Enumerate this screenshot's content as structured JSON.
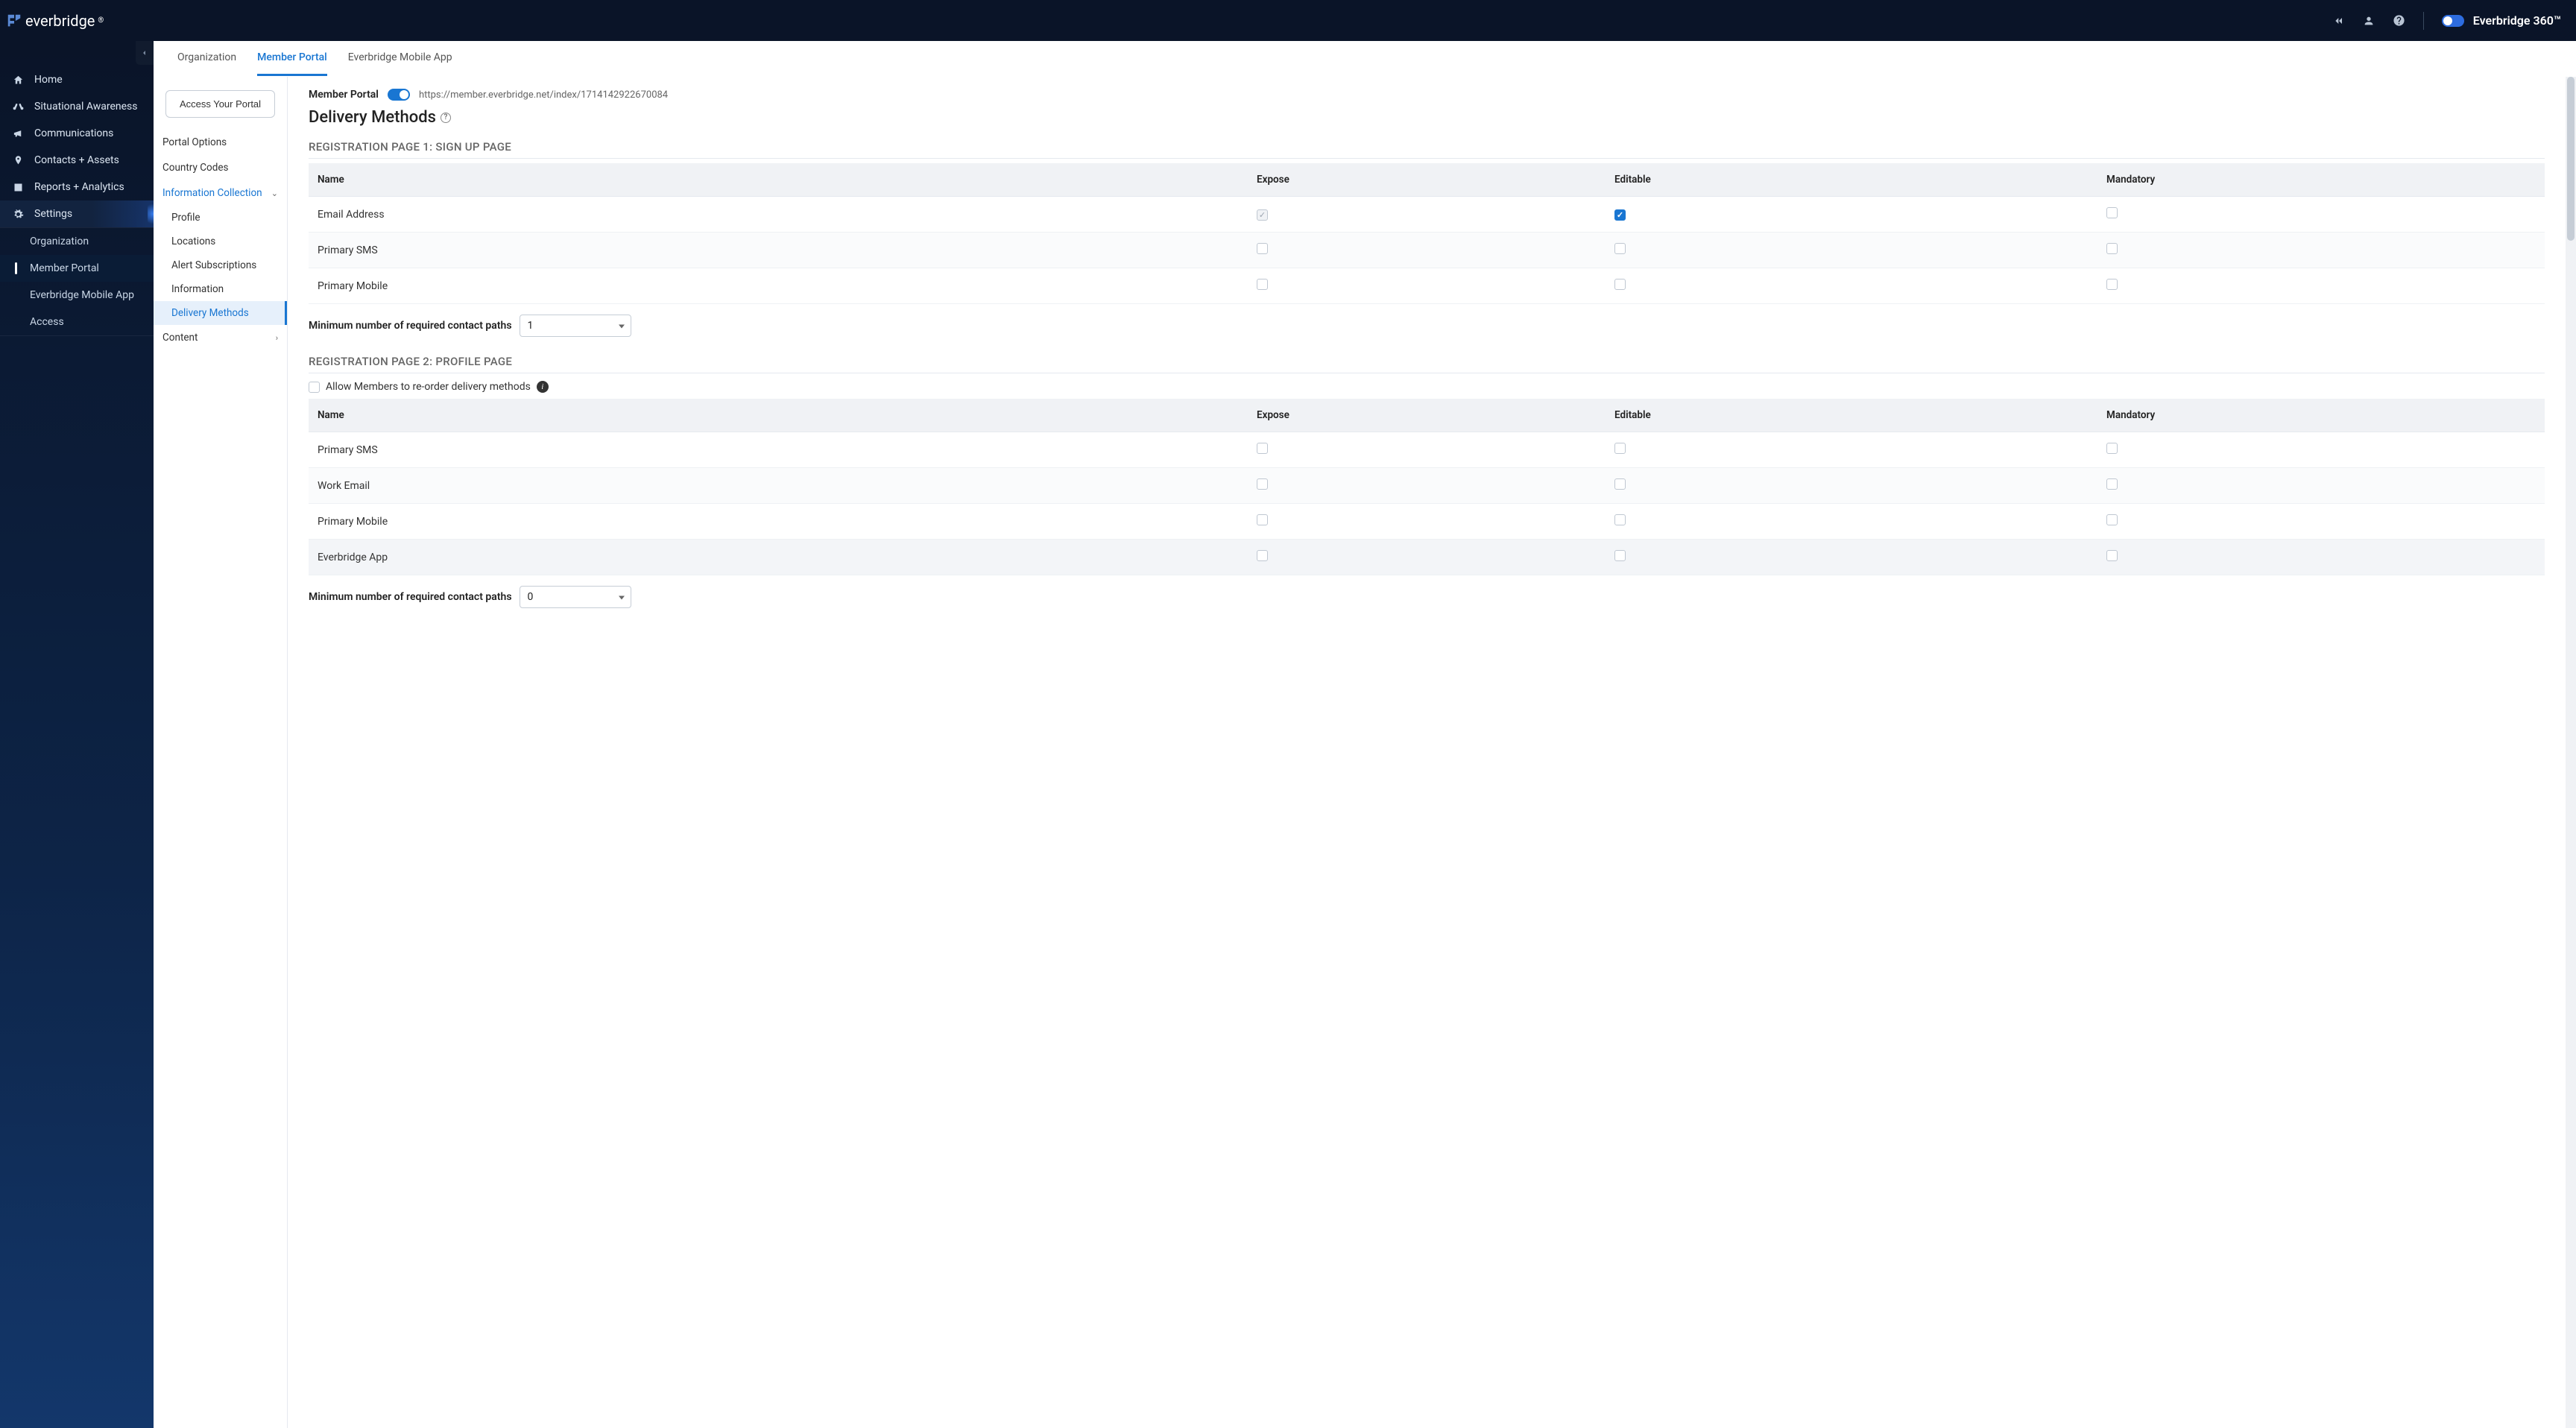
{
  "topbar": {
    "brand": "everbridge",
    "brand360": "Everbridge 360™"
  },
  "sidebar": {
    "items": [
      {
        "label": "Home"
      },
      {
        "label": "Situational Awareness"
      },
      {
        "label": "Communications"
      },
      {
        "label": "Contacts + Assets"
      },
      {
        "label": "Reports + Analytics"
      },
      {
        "label": "Settings"
      }
    ],
    "sub": [
      {
        "label": "Organization"
      },
      {
        "label": "Member Portal"
      },
      {
        "label": "Everbridge Mobile App"
      },
      {
        "label": "Access"
      }
    ]
  },
  "tabs": {
    "items": [
      {
        "label": "Organization"
      },
      {
        "label": "Member Portal"
      },
      {
        "label": "Everbridge Mobile App"
      }
    ]
  },
  "tree": {
    "access_btn": "Access Your Portal",
    "items": {
      "portal_options": "Portal Options",
      "country_codes": "Country Codes",
      "info_collection": "Information Collection",
      "profile": "Profile",
      "locations": "Locations",
      "alert_subs": "Alert Subscriptions",
      "information": "Information",
      "delivery_methods": "Delivery Methods",
      "content": "Content"
    }
  },
  "header": {
    "mp_label": "Member Portal",
    "mp_url": "https://member.everbridge.net/index/1714142922670084",
    "title": "Delivery Methods"
  },
  "section1": {
    "heading": "REGISTRATION PAGE 1: SIGN UP PAGE",
    "cols": {
      "name": "Name",
      "expose": "Expose",
      "editable": "Editable",
      "mandatory": "Mandatory"
    },
    "rows": [
      {
        "name": "Email Address",
        "expose": "locked",
        "editable": "checked",
        "mandatory": ""
      },
      {
        "name": "Primary SMS",
        "expose": "",
        "editable": "",
        "mandatory": ""
      },
      {
        "name": "Primary Mobile",
        "expose": "",
        "editable": "",
        "mandatory": ""
      }
    ],
    "min_label": "Minimum number of required contact paths",
    "min_value": "1"
  },
  "section2": {
    "heading": "REGISTRATION PAGE 2: PROFILE PAGE",
    "reorder_label": "Allow Members to re-order delivery methods",
    "cols": {
      "name": "Name",
      "expose": "Expose",
      "editable": "Editable",
      "mandatory": "Mandatory"
    },
    "rows": [
      {
        "name": "Primary SMS",
        "expose": "",
        "editable": "",
        "mandatory": ""
      },
      {
        "name": "Work Email",
        "expose": "",
        "editable": "",
        "mandatory": ""
      },
      {
        "name": "Primary Mobile",
        "expose": "",
        "editable": "",
        "mandatory": ""
      },
      {
        "name": "Everbridge App",
        "expose": "",
        "editable": "",
        "mandatory": ""
      }
    ],
    "min_label": "Minimum number of required contact paths",
    "min_value": "0"
  }
}
